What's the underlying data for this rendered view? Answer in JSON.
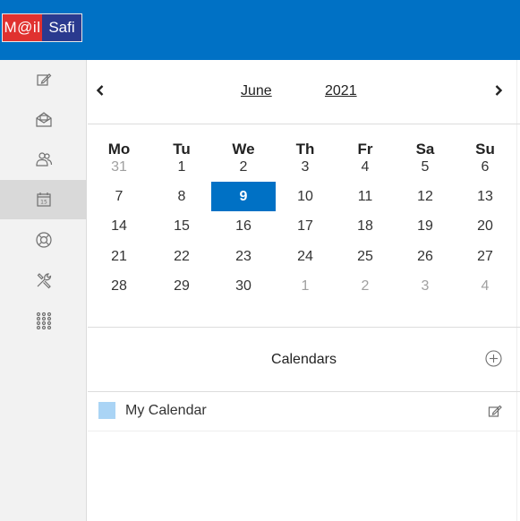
{
  "brand": {
    "left": "M@il",
    "right": "Safi",
    "header_color": "#0071c5"
  },
  "sidebar": {
    "items": [
      {
        "id": "compose",
        "icon": "compose-icon",
        "active": false
      },
      {
        "id": "mail",
        "icon": "envelope-icon",
        "active": false
      },
      {
        "id": "contacts",
        "icon": "contacts-icon",
        "active": false
      },
      {
        "id": "calendar",
        "icon": "calendar-icon",
        "active": true,
        "badge": "15"
      },
      {
        "id": "help",
        "icon": "lifebuoy-icon",
        "active": false
      },
      {
        "id": "settings",
        "icon": "tools-icon",
        "active": false
      },
      {
        "id": "apps",
        "icon": "apps-grid-icon",
        "active": false
      }
    ]
  },
  "calendar": {
    "month": "June",
    "year": "2021",
    "weekdays": [
      "Mo",
      "Tu",
      "We",
      "Th",
      "Fr",
      "Sa",
      "Su"
    ],
    "weeks": [
      [
        "31",
        "1",
        "2",
        "3",
        "4",
        "5",
        "6"
      ],
      [
        "7",
        "8",
        "9",
        "10",
        "11",
        "12",
        "13"
      ],
      [
        "14",
        "15",
        "16",
        "17",
        "18",
        "19",
        "20"
      ],
      [
        "21",
        "22",
        "23",
        "24",
        "25",
        "26",
        "27"
      ],
      [
        "28",
        "29",
        "30",
        "1",
        "2",
        "3",
        "4"
      ]
    ],
    "muted": [
      [
        0,
        0
      ],
      [
        4,
        3
      ],
      [
        4,
        4
      ],
      [
        4,
        5
      ],
      [
        4,
        6
      ]
    ],
    "selected": [
      1,
      2
    ],
    "selected_color": "#0071c5"
  },
  "calendars": {
    "title": "Calendars",
    "items": [
      {
        "name": "My Calendar",
        "color": "#aad4f5"
      }
    ]
  }
}
